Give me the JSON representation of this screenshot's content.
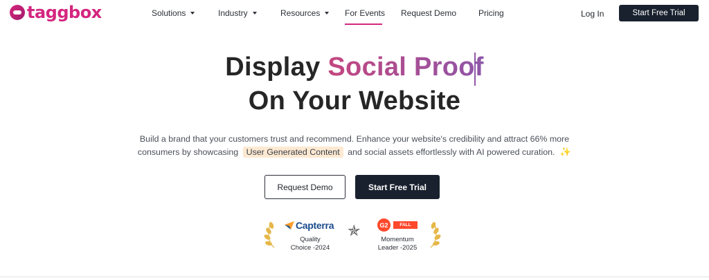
{
  "brand": {
    "name": "taggbox",
    "color": "#d4267f"
  },
  "nav": {
    "items": [
      {
        "label": "Solutions",
        "has_dropdown": true
      },
      {
        "label": "Industry",
        "has_dropdown": true
      },
      {
        "label": "Resources",
        "has_dropdown": true
      },
      {
        "label": "For Events",
        "has_dropdown": false,
        "active": true
      },
      {
        "label": "Request Demo",
        "has_dropdown": false
      },
      {
        "label": "Pricing",
        "has_dropdown": false
      }
    ],
    "login": "Log In",
    "cta": "Start Free Trial"
  },
  "hero": {
    "headline_prefix": "Display",
    "headline_highlight": "Social Proof",
    "headline_line2": "On Your Website",
    "desc_line1": "Build a brand that your customers trust and recommend. Enhance your website's credibility and attract 66% more",
    "desc_line2_before": "consumers by showcasing",
    "desc_highlight": "User Generated Content",
    "desc_line2_after": "and social assets effortlessly with AI powered curation.",
    "btn_secondary": "Request Demo",
    "btn_primary": "Start Free Trial"
  },
  "badges": {
    "capterra": {
      "logo": "Capterra",
      "line1": "Quality",
      "line2": "Choice -2024"
    },
    "g2": {
      "logo": "G2",
      "tag": "FALL",
      "line1": "Momentum",
      "line2": "Leader -2025"
    }
  },
  "colors": {
    "dark_button": "#19212e",
    "highlight_bg": "#fde9d2",
    "accent_gradient_start": "#c4467f",
    "accent_gradient_end": "#8e56a8"
  }
}
